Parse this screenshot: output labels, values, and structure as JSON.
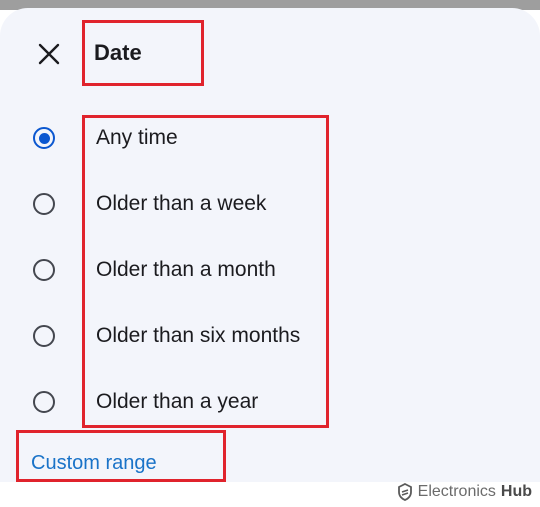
{
  "dialog": {
    "title": "Date",
    "close_icon": "close-icon",
    "options": [
      {
        "label": "Any time",
        "selected": true
      },
      {
        "label": "Older than a week",
        "selected": false
      },
      {
        "label": "Older than a month",
        "selected": false
      },
      {
        "label": "Older than six months",
        "selected": false
      },
      {
        "label": "Older than a year",
        "selected": false
      }
    ],
    "custom_range": "Custom range"
  },
  "watermark": {
    "brand": "Electronics",
    "suffix": "Hub"
  },
  "colors": {
    "accent": "#0b57d0",
    "link": "#1a73c8",
    "highlight": "#e0232c",
    "sheet": "#f3f5fb"
  }
}
